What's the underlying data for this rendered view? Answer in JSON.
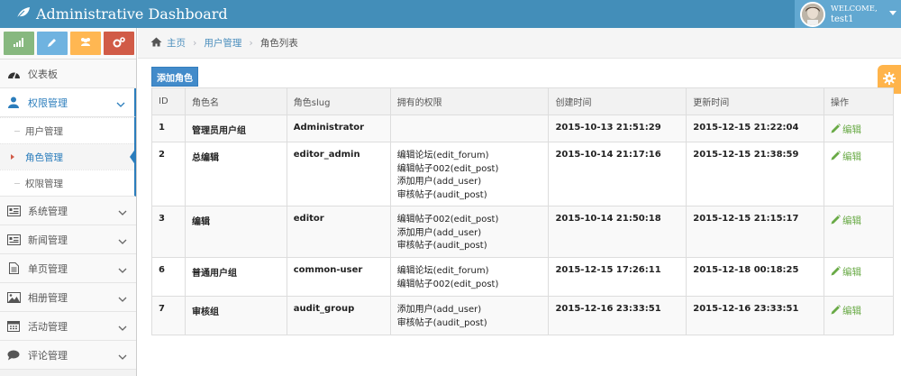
{
  "app": {
    "title": "Administrative Dashboard"
  },
  "user": {
    "welcome": "WELCOME,",
    "name": "test1"
  },
  "shortcuts": [
    {
      "icon": "signal-icon",
      "color": "#87b87f"
    },
    {
      "icon": "pencil-icon",
      "color": "#6fb3e0"
    },
    {
      "icon": "users-icon",
      "color": "#ffb752"
    },
    {
      "icon": "cogs-icon",
      "color": "#d15b47"
    }
  ],
  "sidebar": {
    "dashboard": "仪表板",
    "permissions": "权限管理",
    "sub": [
      "用户管理",
      "角色管理",
      "权限管理"
    ],
    "items": [
      "系统管理",
      "新闻管理",
      "单页管理",
      "相册管理",
      "活动管理",
      "评论管理"
    ]
  },
  "breadcrumb": {
    "home": "主页",
    "section": "用户管理",
    "current": "角色列表"
  },
  "toolbar": {
    "add_label": "添加角色"
  },
  "table": {
    "headers": [
      "ID",
      "角色名",
      "角色slug",
      "拥有的权限",
      "创建时间",
      "更新时间",
      "操作"
    ],
    "edit_label": "编辑",
    "rows": [
      {
        "id": "1",
        "name": "管理员用户组",
        "slug": "Administrator",
        "perms": [],
        "created": "2015-10-13 21:51:29",
        "updated": "2015-12-15 21:22:04"
      },
      {
        "id": "2",
        "name": "总编辑",
        "slug": "editor_admin",
        "perms": [
          "编辑论坛(edit_forum)",
          "编辑帖子002(edit_post)",
          "添加用户(add_user)",
          "审核帖子(audit_post)"
        ],
        "created": "2015-10-14 21:17:16",
        "updated": "2015-12-15 21:38:59"
      },
      {
        "id": "3",
        "name": "编辑",
        "slug": "editor",
        "perms": [
          "编辑帖子002(edit_post)",
          "添加用户(add_user)",
          "审核帖子(audit_post)"
        ],
        "created": "2015-10-14 21:50:18",
        "updated": "2015-12-15 21:15:17"
      },
      {
        "id": "6",
        "name": "普通用户组",
        "slug": "common-user",
        "perms": [
          "编辑论坛(edit_forum)",
          "编辑帖子002(edit_post)"
        ],
        "created": "2015-12-15 17:26:11",
        "updated": "2015-12-18 00:18:25"
      },
      {
        "id": "7",
        "name": "审核组",
        "slug": "audit_group",
        "perms": [
          "添加用户(add_user)",
          "审核帖子(audit_post)"
        ],
        "created": "2015-12-16 23:33:51",
        "updated": "2015-12-16 23:33:51"
      }
    ]
  }
}
